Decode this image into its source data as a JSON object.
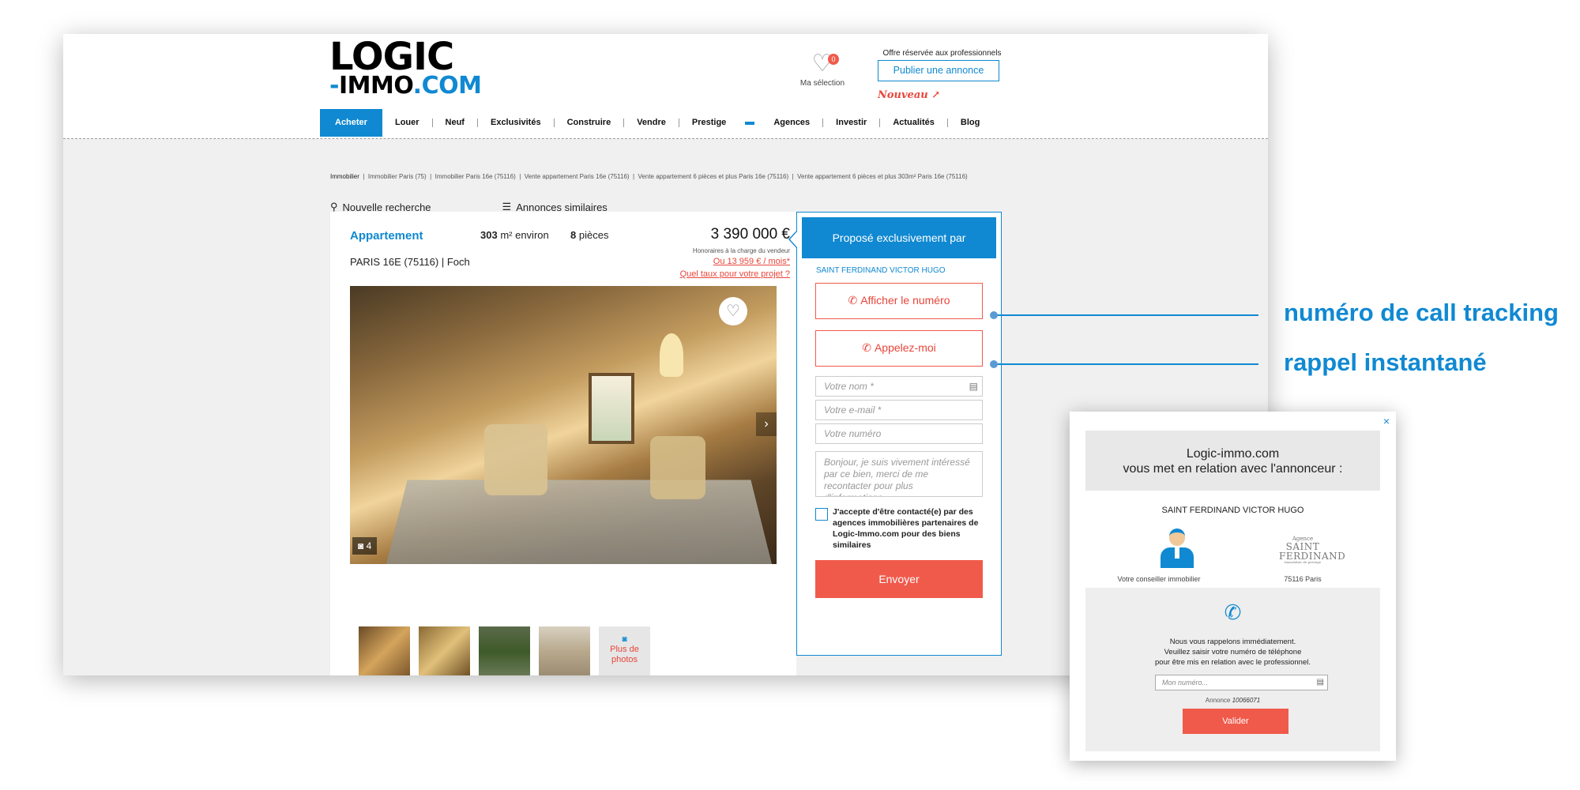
{
  "header": {
    "logo_line1": "LOGIC",
    "logo_dash": "-",
    "logo_immo": "IMMO",
    "logo_com": ".COM",
    "favorites_count": "0",
    "favorites_label": "Ma sélection",
    "pro_label": "Offre réservée aux professionnels",
    "publish_label": "Publier une annonce",
    "new_label": "Nouveau ↗"
  },
  "nav": {
    "items": [
      "Acheter",
      "Louer",
      "Neuf",
      "Exclusivités",
      "Construire",
      "Vendre",
      "Prestige",
      "Agences",
      "Investir",
      "Actualités",
      "Blog"
    ]
  },
  "breadcrumb": {
    "items": [
      "Immobilier",
      "Immobilier Paris (75)",
      "Immobilier Paris 16e (75116)",
      "Vente appartement Paris 16e (75116)",
      "Vente appartement 6 pièces et plus Paris 16e (75116)",
      "Vente appartement 6 pièces et plus 303m² Paris 16e (75116)"
    ]
  },
  "tools": {
    "new_search": "Nouvelle recherche",
    "similar": "Annonces similaires"
  },
  "listing": {
    "type": "Appartement",
    "surface_value": "303",
    "surface_unit": "m² environ",
    "rooms_value": "8",
    "rooms_unit": "pièces",
    "price": "3 390 000 €",
    "fees": "Honoraires à la charge du vendeur",
    "monthly": "Ou 13 959 € / mois*",
    "rate_link": "Quel taux pour votre projet ?",
    "location": "PARIS 16E (75116) | Foch",
    "photo_count": "4",
    "more_photos": "Plus de photos"
  },
  "contact": {
    "header": "Proposé exclusivement par",
    "agency": "SAINT FERDINAND VICTOR HUGO",
    "show_number": "Afficher le numéro",
    "call_me": "Appelez-moi",
    "name_placeholder": "Votre nom *",
    "email_placeholder": "Votre e-mail *",
    "phone_placeholder": "Votre numéro",
    "message": "Bonjour, je suis vivement intéressé par ce bien, merci de me recontacter pour plus d'informations.",
    "consent": "J'accepte d'être contacté(e) par des agences immobilières partenaires de Logic-Immo.com pour des biens similaires",
    "send": "Envoyer"
  },
  "callouts": {
    "call_tracking": "numéro de call tracking",
    "instant_callback": "rappel instantané"
  },
  "popup": {
    "close": "×",
    "title_line1": "Logic-immo.com",
    "title_line2": "vous met en relation avec l'annonceur :",
    "agency": "SAINT FERDINAND VICTOR HUGO",
    "logo_small": "Agence",
    "logo_big1": "SAINT",
    "logo_big2": "FERDINAND",
    "logo_tiny": "Immobilier de prestige",
    "advisor_caption": "Votre conseiller immobilier",
    "location_caption": "75116 Paris",
    "text_line1": "Nous vous rappelons immédiatement.",
    "text_line2": "Veuillez saisir votre numéro de téléphone",
    "text_line3": "pour être mis en relation avec le professionnel.",
    "phone_placeholder": "Mon numéro...",
    "ref_label": "Annonce",
    "ref_number": "10066071",
    "validate": "Valider"
  },
  "colors": {
    "brand_blue": "#1089d2",
    "action_red": "#f05a4b"
  },
  "icons": [
    "heart-icon",
    "search-icon",
    "list-icon",
    "phone-icon",
    "callback-icon",
    "camera-icon",
    "chevron-right-icon",
    "id-card-icon",
    "close-icon"
  ]
}
